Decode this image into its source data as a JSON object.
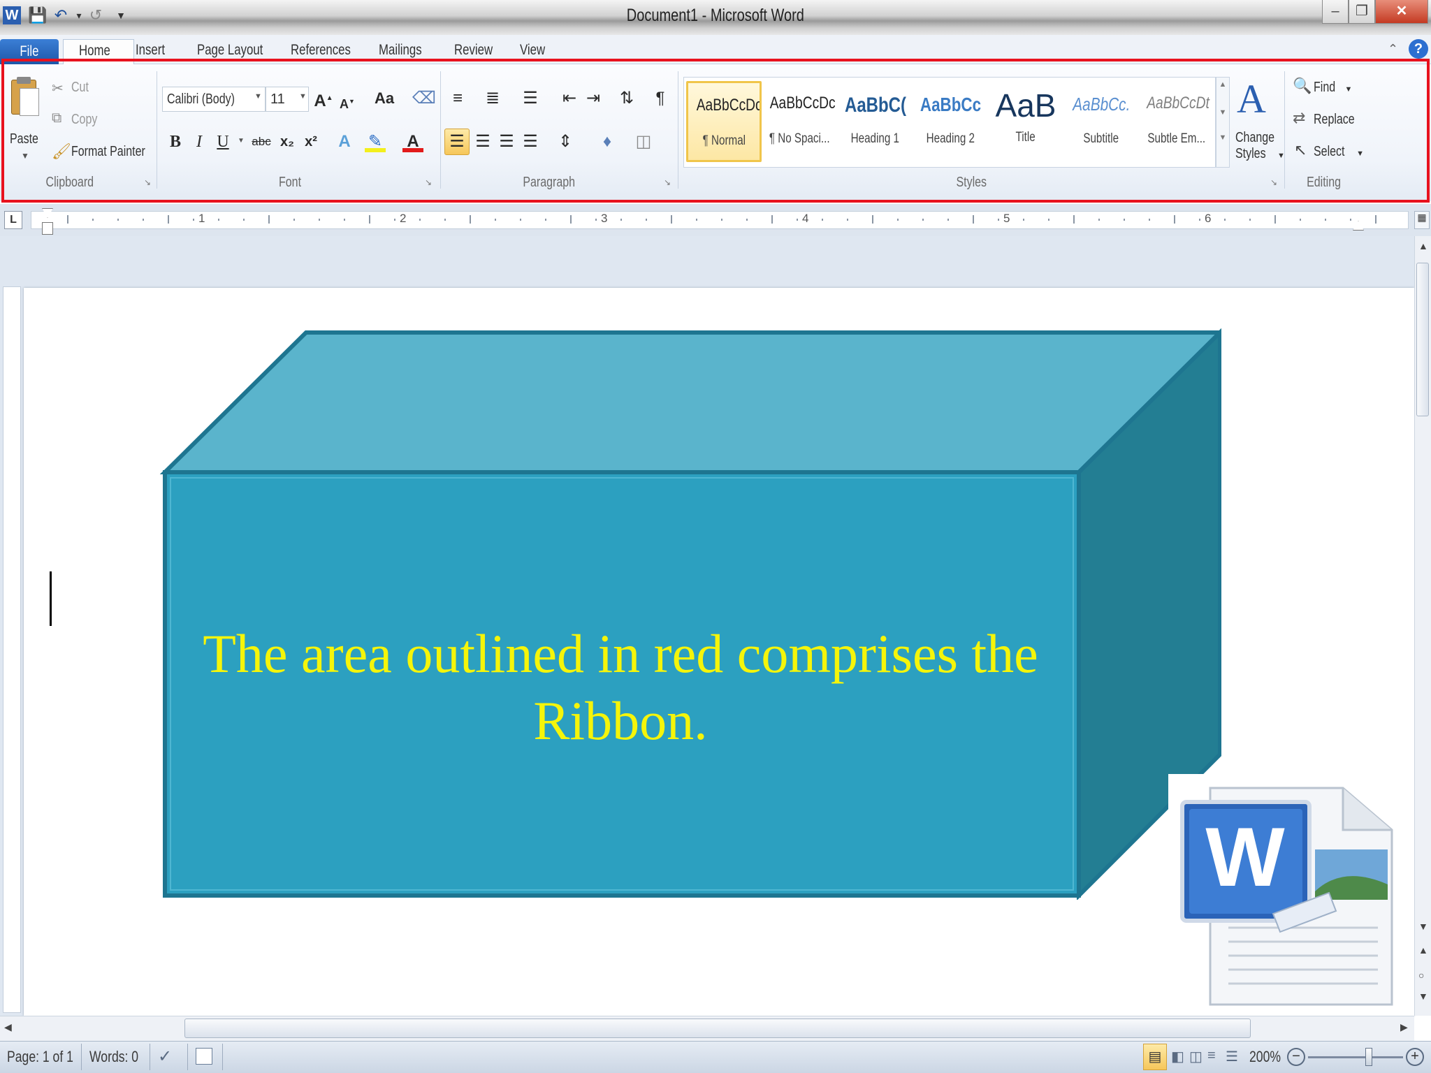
{
  "window": {
    "title": "Document1 - Microsoft Word"
  },
  "quick_access": {
    "app_icon": "W"
  },
  "tabs": [
    "File",
    "Home",
    "Insert",
    "Page Layout",
    "References",
    "Mailings",
    "Review",
    "View"
  ],
  "active_tab": "Home",
  "ribbon": {
    "clipboard": {
      "label": "Clipboard",
      "paste": "Paste",
      "cut": "Cut",
      "copy": "Copy",
      "format_painter": "Format Painter"
    },
    "font": {
      "label": "Font",
      "font_name": "Calibri (Body)",
      "font_size": "11",
      "bold": "B",
      "italic": "I",
      "underline": "U",
      "strikethrough": "abc",
      "subscript": "x₂",
      "superscript": "x²",
      "grow": "A",
      "shrink": "A",
      "change_case": "Aa"
    },
    "paragraph": {
      "label": "Paragraph",
      "pilcrow": "¶"
    },
    "styles": {
      "label": "Styles",
      "items": [
        {
          "sample": "AaBbCcDc",
          "name": "¶ Normal"
        },
        {
          "sample": "AaBbCcDc",
          "name": "¶ No Spaci..."
        },
        {
          "sample": "AaBbC(",
          "name": "Heading 1"
        },
        {
          "sample": "AaBbCc",
          "name": "Heading 2"
        },
        {
          "sample": "AaB",
          "name": "Title"
        },
        {
          "sample": "AaBbCc.",
          "name": "Subtitle"
        },
        {
          "sample": "AaBbCcDt",
          "name": "Subtle Em..."
        }
      ],
      "change_styles_line1": "Change",
      "change_styles_line2": "Styles"
    },
    "editing": {
      "label": "Editing",
      "find": "Find",
      "replace": "Replace",
      "select": "Select"
    }
  },
  "ruler": {
    "numbers": [
      "1",
      "2",
      "3",
      "4",
      "5",
      "6"
    ],
    "tab_marker": "L"
  },
  "callout": {
    "text_line1": "The area outlined in red comprises the",
    "text_line2": "Ribbon."
  },
  "status": {
    "page": "Page: 1 of 1",
    "words": "Words: 0",
    "zoom": "200%"
  },
  "colors": {
    "ribbon_outline": "#e8121e",
    "callout_front": "#2ca0c0",
    "callout_top": "#5ab4cc",
    "callout_side": "#237e93",
    "callout_text": "#f5f50a"
  }
}
